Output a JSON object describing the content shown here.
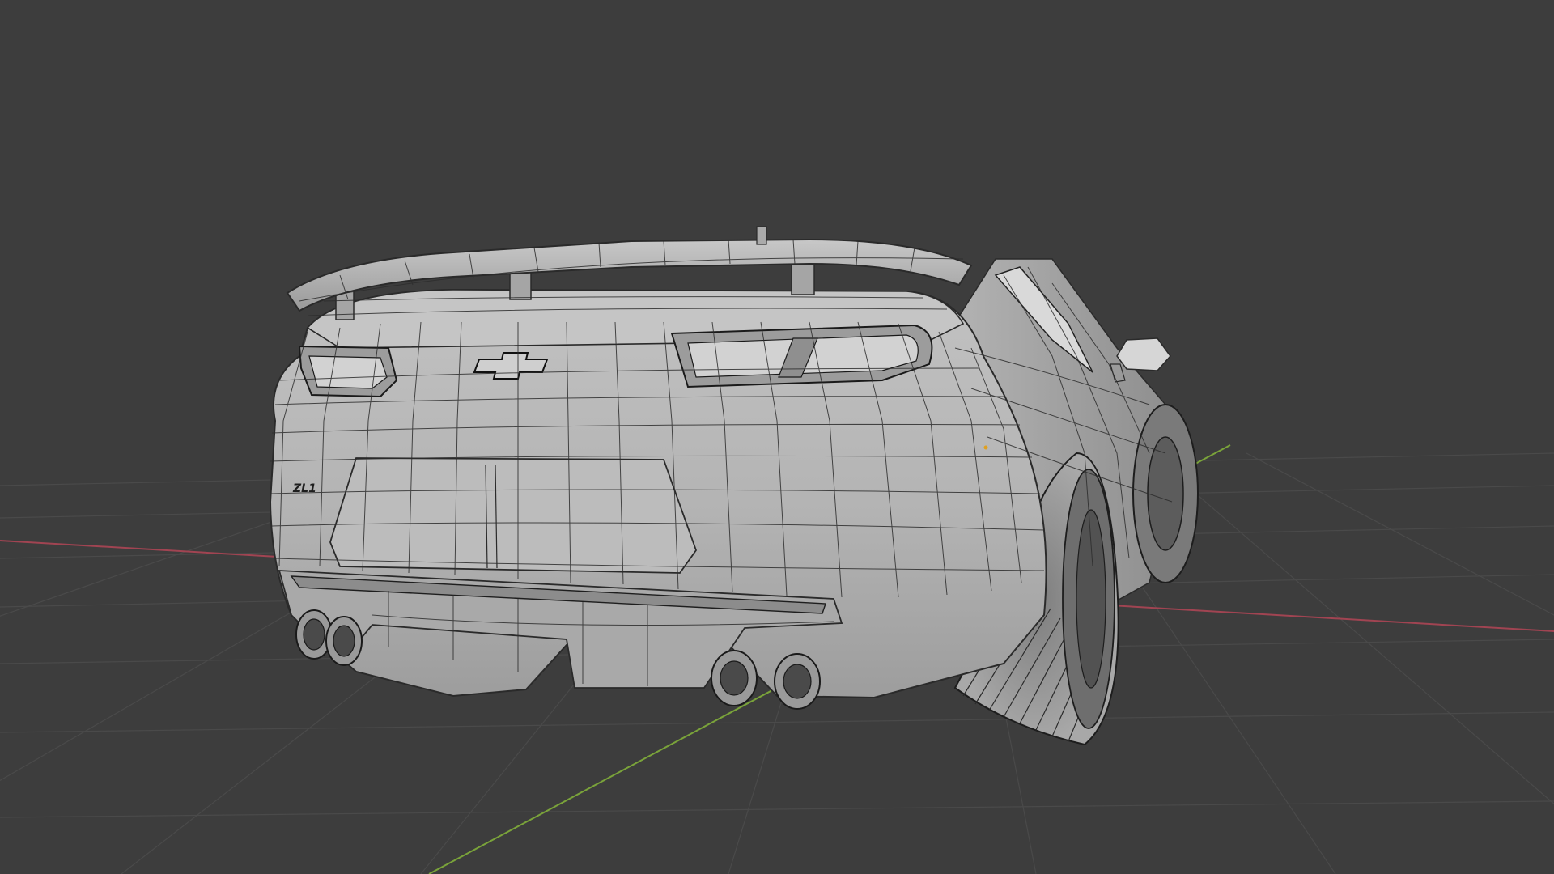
{
  "viewport": {
    "background_color": "#3d3d3d",
    "grid_color": "#4b4b4b",
    "x_axis_color": "#b04a55",
    "y_axis_color": "#7aa33a"
  },
  "model": {
    "body_color": "#b4b4b4",
    "wire_color": "#2a2a2a",
    "badge_text": "ZL1"
  }
}
